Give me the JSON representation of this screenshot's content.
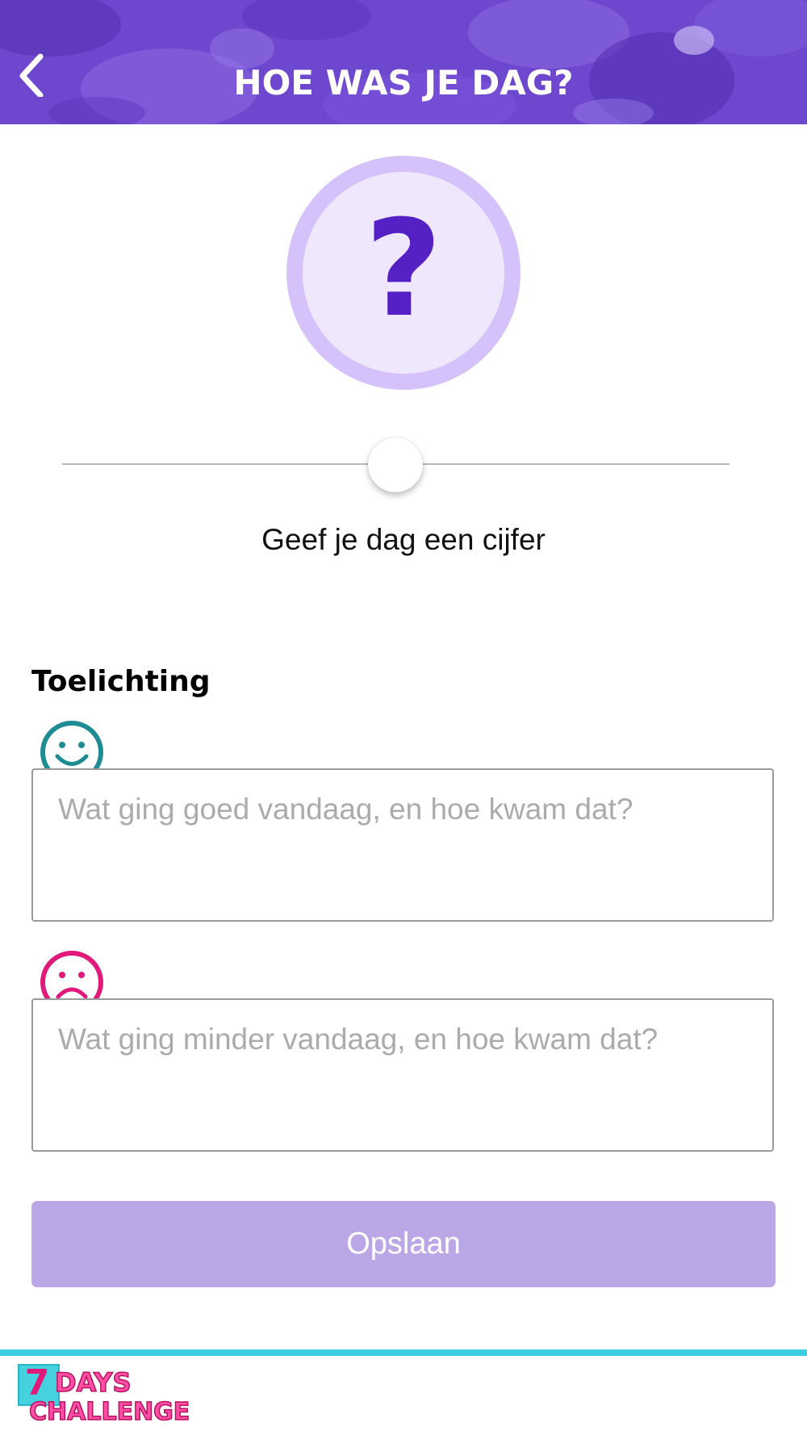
{
  "header": {
    "title": "HOE WAS JE DAG?",
    "back_icon": "chevron-left-icon"
  },
  "mood": {
    "symbol": "?"
  },
  "rating": {
    "label": "Geef je dag een cijfer"
  },
  "explanation": {
    "title": "Toelichting",
    "positive": {
      "icon": "smiley-happy-icon",
      "placeholder": "Wat ging goed vandaag, en hoe kwam dat?",
      "value": ""
    },
    "negative": {
      "icon": "smiley-sad-icon",
      "placeholder": "Wat ging minder vandaag, en hoe kwam dat?",
      "value": ""
    }
  },
  "actions": {
    "save_label": "Opslaan"
  },
  "footer": {
    "logo_number": "7",
    "logo_line1": "DAYS",
    "logo_line2": "CHALLENGE"
  },
  "colors": {
    "header": "#6b45cc",
    "accent_purple": "#5520c4",
    "circle_outer": "#d6c2fb",
    "circle_inner": "#efe8fd",
    "save_button": "#bba6e6",
    "happy_teal": "#1f8c94",
    "sad_pink": "#e0197a",
    "footer_line": "#3dcfe0"
  }
}
